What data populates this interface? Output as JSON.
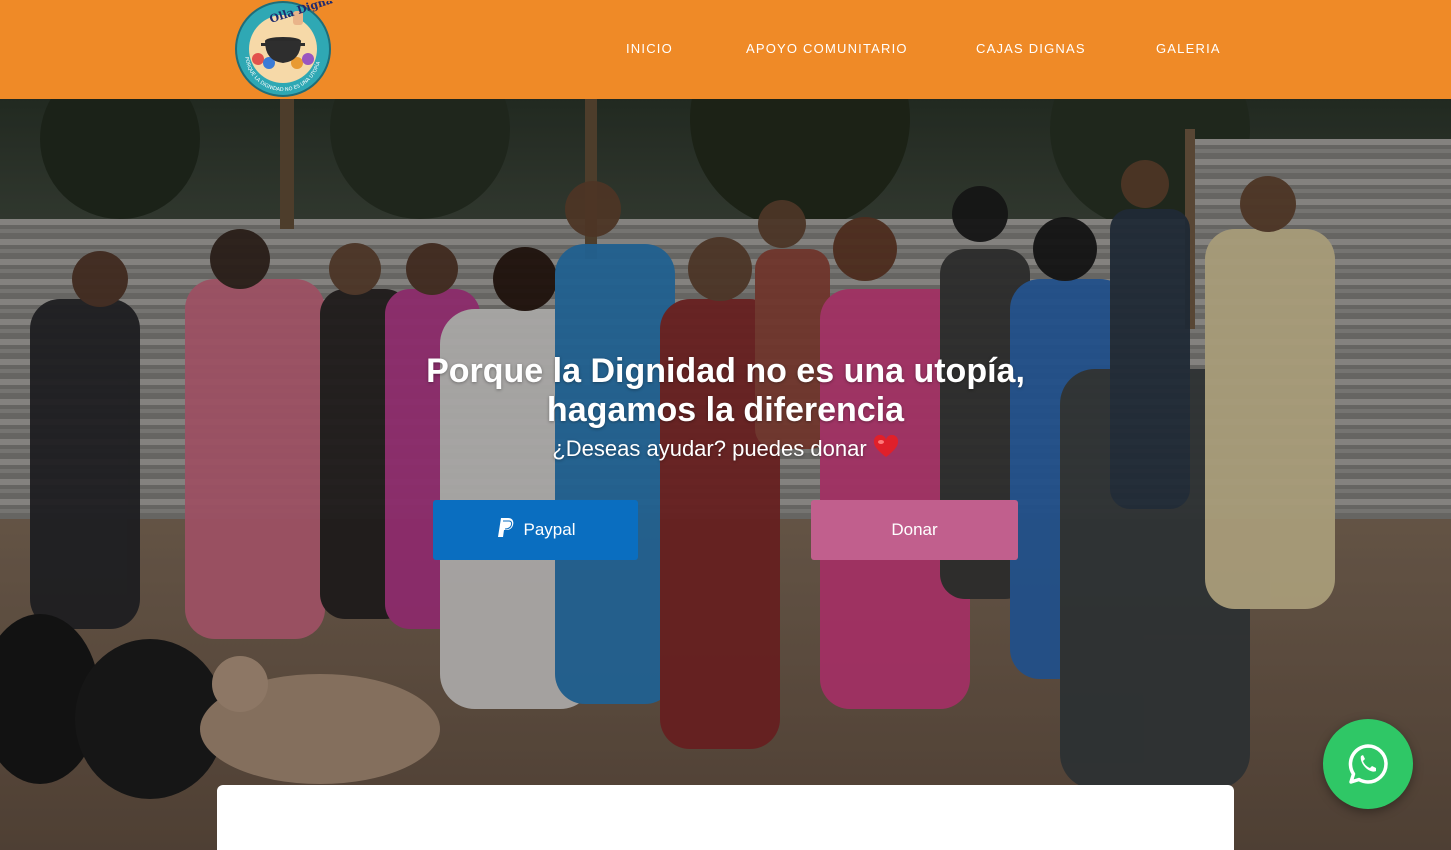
{
  "header": {
    "background_color": "#ef8a27",
    "logo": {
      "top_text": "Olla Digna",
      "ring_text": "PORQUE LA DIGNIDAD NO ES UNA UTOPÍA",
      "icon": "cooking-pot-logo"
    },
    "nav": [
      {
        "label": "INICIO"
      },
      {
        "label": "APOYO COMUNITARIO"
      },
      {
        "label": "CAJAS DIGNAS"
      },
      {
        "label": "GALERIA"
      }
    ]
  },
  "hero": {
    "title_line1": "Porque la Dignidad no es una utopía,",
    "title_line2": "hagamos la diferencia",
    "subtitle": "¿Deseas ayudar? puedes donar",
    "heart_icon": "red-heart-icon",
    "buttons": {
      "paypal_label": "Paypal",
      "paypal_color": "#0a6ec0",
      "donar_label": "Donar",
      "donar_color": "#c15f8d"
    },
    "background_image": "group-photo-community-kitchen"
  },
  "floating": {
    "whatsapp_icon": "whatsapp-icon",
    "whatsapp_color": "#2fc766"
  }
}
